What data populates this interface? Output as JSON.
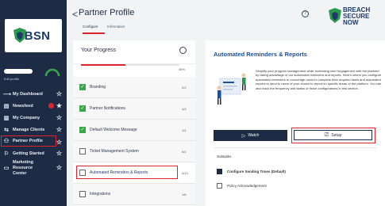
{
  "sidebar": {
    "logo_text": "BSN",
    "user_subtitle": "Edit profile",
    "nav": [
      {
        "label": "My Dashboard",
        "icon": "dashboard-icon",
        "icon_glyph": "⟶"
      },
      {
        "label": "Newsfeed",
        "icon": "newsfeed-icon",
        "icon_glyph": "▤"
      },
      {
        "label": "My Company",
        "icon": "company-icon",
        "icon_glyph": "▥"
      },
      {
        "label": "Manage Clients",
        "icon": "manage-clients-icon",
        "icon_glyph": "⇆"
      },
      {
        "label": "Partner Profile",
        "icon": "partner-profile-icon",
        "icon_glyph": "⚇"
      },
      {
        "label": "Getting Started",
        "icon": "getting-started-icon",
        "icon_glyph": "⚐"
      },
      {
        "label": "Marketing Resource Center",
        "icon": "marketing-icon",
        "icon_glyph": "▭"
      }
    ]
  },
  "header": {
    "back_glyph": "<",
    "title": "Partner Profile",
    "tabs": [
      "Configure",
      "Information"
    ],
    "help_glyph": "?",
    "brand_line1": "BREACH",
    "brand_line2": "SECURE NOW"
  },
  "progress": {
    "title": "Your Progress",
    "percent": "45%",
    "fill_fraction": 0.45,
    "items": [
      {
        "label": "Branding",
        "count": "2/2",
        "checked": true
      },
      {
        "label": "Partner Notifications",
        "count": "4/4",
        "checked": true
      },
      {
        "label": "Default Welcome Message",
        "count": "1/1",
        "checked": true
      },
      {
        "label": "Ticket Management System",
        "count": "0/1",
        "checked": false
      },
      {
        "label": "Automated Reminders & Reports",
        "count": "4/13",
        "checked": false,
        "selected": true
      },
      {
        "label": "Integrations",
        "count": "1/6",
        "checked": false
      }
    ]
  },
  "detail": {
    "title": "Automated Reminders & Reports",
    "description": "Simplify your program management while increasing user engagement with the platform by taking advantage of our automated reminders and reports. Here's where you configure automated reminders to encourage users to complete their required tasks and automated reports to send to users of your choice to report on specific areas of the platform. You can also track the frequency and status of those configurations in this section.",
    "watch_label": "Watch",
    "setup_label": "Setup",
    "subtasks_label": "Subtasks",
    "subtasks": [
      {
        "label": "Configure Sending Times (Default)",
        "checked": true
      },
      {
        "label": "Policy Acknowledgement",
        "checked": false
      }
    ]
  },
  "colors": {
    "navy": "#1d2b45",
    "accent_red": "#e0242b",
    "check_green": "#3aa64a",
    "title_blue": "#1a4f9c"
  }
}
